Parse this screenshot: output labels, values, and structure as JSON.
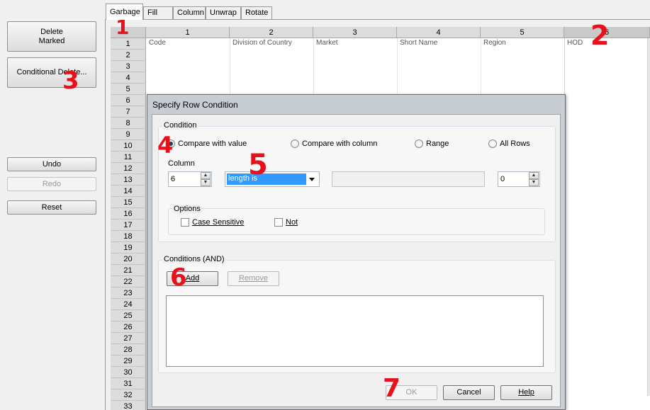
{
  "left_panel": {
    "delete_marked": "Delete\nMarked",
    "conditional_delete": "Conditional Delete...",
    "undo": "Undo",
    "redo": "Redo",
    "reset": "Reset"
  },
  "tabs": [
    "Garbage",
    "Fill",
    "Column",
    "Unwrap",
    "Rotate"
  ],
  "grid": {
    "columns": [
      "1",
      "2",
      "3",
      "4",
      "5",
      "6"
    ],
    "rows": [
      "1",
      "2",
      "3",
      "4",
      "5",
      "6",
      "7",
      "8",
      "9",
      "10",
      "11",
      "12",
      "13",
      "14",
      "15",
      "16",
      "17",
      "18",
      "19",
      "20",
      "21",
      "22",
      "23",
      "24",
      "25",
      "26",
      "27",
      "28",
      "29",
      "30",
      "31",
      "32",
      "33"
    ],
    "cells": {
      "r1c1": "Code",
      "r1c2": "Division of Country",
      "r1c3": "Market",
      "r1c4": "Short Name",
      "r1c5": "Region",
      "r1c6": "HOD"
    }
  },
  "dialog": {
    "title": "Specify Row Condition",
    "condition_group": "Condition",
    "radio_value": "Compare with value",
    "radio_column": "Compare with column",
    "radio_range": "Range",
    "radio_all": "All Rows",
    "column_label": "Column",
    "column_value": "6",
    "operator_value": "length is",
    "compare_value": "",
    "number_value": "0",
    "options_group": "Options",
    "case_sensitive": "Case Sensitive",
    "not_label": "Not",
    "conditions_group": "Conditions (AND)",
    "add": "Add",
    "remove": "Remove",
    "ok": "OK",
    "cancel": "Cancel",
    "help": "Help"
  },
  "annotations": [
    "1",
    "2",
    "3",
    "4",
    "5",
    "6",
    "7"
  ],
  "colors": {
    "selection": "#3399ff",
    "annotation": "#e8101a",
    "dialog_frame": "#c8cdd4"
  }
}
